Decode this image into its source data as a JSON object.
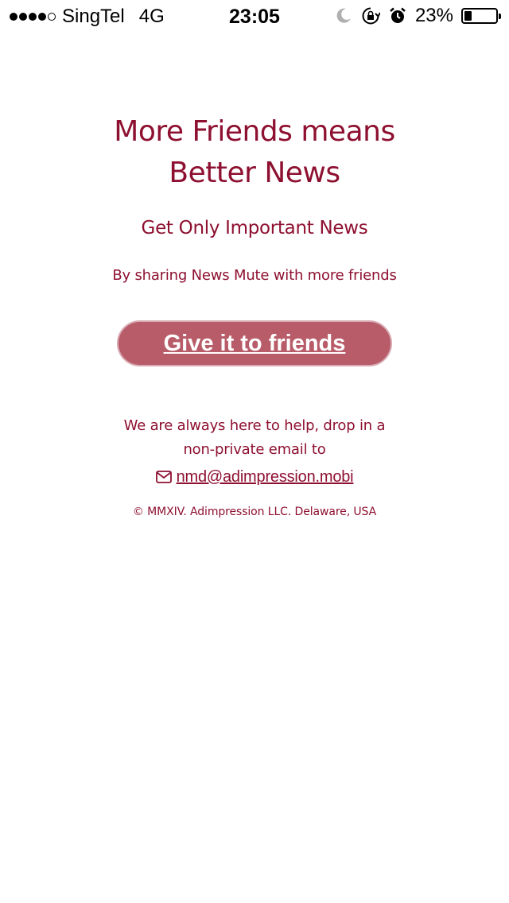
{
  "status_bar": {
    "signal_bars_filled": 4,
    "signal_bars_total": 5,
    "carrier": "SingTel",
    "network": "4G",
    "time": "23:05",
    "battery_percent": "23%",
    "battery_level": 0.23,
    "icons": [
      "moon-icon",
      "rotation-lock-icon",
      "alarm-icon",
      "battery-icon"
    ]
  },
  "main": {
    "headline": "More Friends means Better News",
    "subhead": "Get Only Important News",
    "tagline": "By sharing News Mute with more friends",
    "cta_label": "Give it to friends",
    "help_line1": "We are always here to help, drop in a",
    "help_line2": "non-private email to",
    "email": "nmd@adimpression.mobi",
    "copyright": "© MMXIV. Adimpression LLC. Delaware, USA"
  },
  "colors": {
    "text_accent": "#8e1030",
    "button_bg": "#b85c69",
    "button_border": "#d8aab4"
  }
}
